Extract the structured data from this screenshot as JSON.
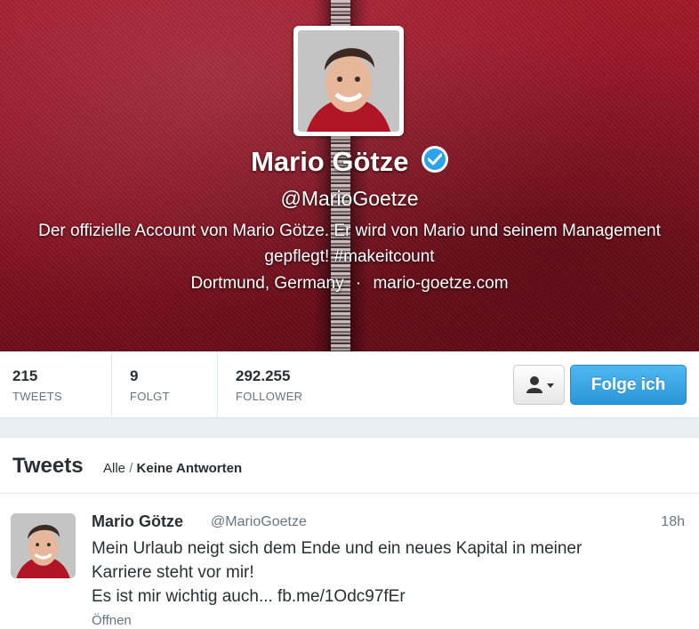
{
  "profile": {
    "name": "Mario Götze",
    "handle": "@MarioGoetze",
    "bio": "Der offizielle Account von Mario Götze. Er wird von Mario und seinem Management gepflegt! #makeitcount",
    "location": "Dortmund, Germany",
    "separator": "·",
    "website": "mario-goetze.com",
    "verified": true,
    "banner_color": "#8f1424"
  },
  "stats": [
    {
      "value": "215",
      "label": "TWEETS"
    },
    {
      "value": "9",
      "label": "FOLGT"
    },
    {
      "value": "292.255",
      "label": "FOLLOWER"
    }
  ],
  "actions": {
    "user_menu_icon": "user-icon",
    "follow_label": "Folge ich",
    "accent_color": "#2aa3ef"
  },
  "tweets_section": {
    "title": "Tweets",
    "filter_all": "Alle",
    "filter_sep": "/",
    "filter_no_replies": "Keine Antworten"
  },
  "tweet": {
    "name": "Mario Götze",
    "handle": "@MarioGoetze",
    "time": "18h",
    "line1": "Mein Urlaub neigt sich dem Ende und ein neues Kapital in meiner",
    "line2": "Karriere steht vor mir!",
    "line3": "Es ist mir wichtig auch... fb.me/1Odc97fEr",
    "open_label": "Öffnen"
  }
}
